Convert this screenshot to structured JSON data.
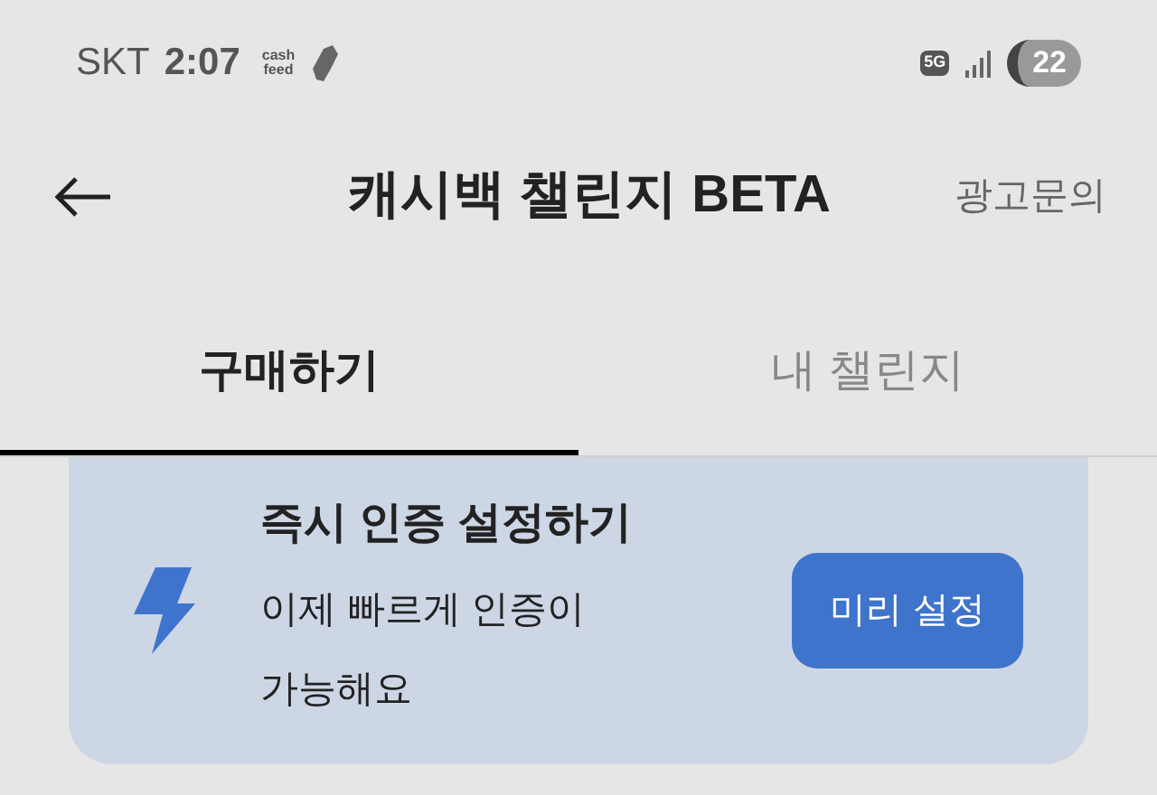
{
  "status_bar": {
    "carrier": "SKT",
    "time": "2:07",
    "app_badge": "cash\nfeed",
    "network": "5G",
    "battery": "22"
  },
  "header": {
    "title": "캐시백 챌린지 BETA",
    "action": "광고문의"
  },
  "tabs": [
    {
      "label": "구매하기",
      "selected": true
    },
    {
      "label": "내 챌린지",
      "selected": false
    }
  ],
  "banner": {
    "title": "즉시 인증 설정하기",
    "description": "이제 빠르게 인증이 가능해요",
    "button": "미리 설정"
  }
}
